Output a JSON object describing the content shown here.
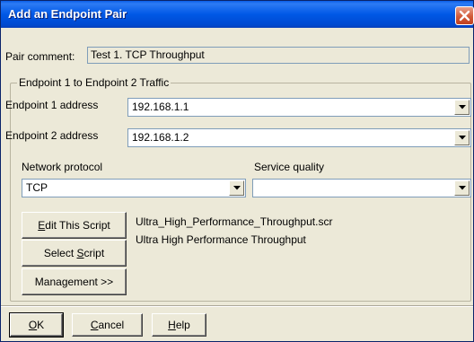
{
  "window": {
    "title": "Add an Endpoint Pair"
  },
  "pair_comment": {
    "label": "Pair comment:",
    "value": "Test 1. TCP Throughput"
  },
  "traffic_group": {
    "title": "Endpoint 1 to Endpoint 2 Traffic",
    "endpoint1": {
      "label": "Endpoint 1 address",
      "value": "192.168.1.1"
    },
    "endpoint2": {
      "label": "Endpoint 2 address",
      "value": "192.168.1.2"
    },
    "network_protocol": {
      "label": "Network protocol",
      "value": "TCP"
    },
    "service_quality": {
      "label": "Service quality",
      "value": ""
    },
    "script": {
      "filename": "Ultra_High_Performance_Throughput.scr",
      "description": "Ultra High Performance Throughput"
    },
    "buttons": {
      "edit_pre": "",
      "edit_mnemonic": "E",
      "edit_post": "dit This Script",
      "select_pre": "Select ",
      "select_mnemonic": "S",
      "select_post": "cript",
      "management": "Management >>"
    }
  },
  "footer_buttons": {
    "ok_mnemonic": "O",
    "ok_post": "K",
    "cancel_mnemonic": "C",
    "cancel_post": "ancel",
    "help_mnemonic": "H",
    "help_post": "elp"
  },
  "colors": {
    "titlebar": "#0058e6",
    "dialog_bg": "#ece9d8",
    "close_button": "#d25a39",
    "field_border": "#7f9db9"
  },
  "icons": {
    "close": "close-icon",
    "dropdown": "chevron-down-icon"
  }
}
